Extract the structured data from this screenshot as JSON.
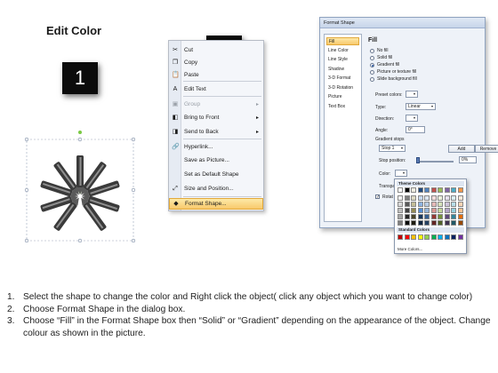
{
  "title": "Edit Color",
  "steps": [
    "1",
    "2",
    "3"
  ],
  "context_menu": {
    "items": [
      {
        "label": "Cut",
        "icon": "scissors-icon",
        "disabled": false,
        "submenu": false
      },
      {
        "label": "Copy",
        "icon": "copy-icon",
        "disabled": false,
        "submenu": false
      },
      {
        "label": "Paste",
        "icon": "paste-icon",
        "disabled": false,
        "submenu": false
      },
      {
        "label": "Edit Text",
        "icon": "edit-text-icon",
        "disabled": false,
        "submenu": false
      },
      {
        "label": "Group",
        "icon": "group-icon",
        "disabled": true,
        "submenu": true
      },
      {
        "label": "Bring to Front",
        "icon": "bring-front-icon",
        "disabled": false,
        "submenu": true
      },
      {
        "label": "Send to Back",
        "icon": "send-back-icon",
        "disabled": false,
        "submenu": true
      },
      {
        "label": "Hyperlink...",
        "icon": "hyperlink-icon",
        "disabled": false,
        "submenu": false
      },
      {
        "label": "Save as Picture...",
        "icon": "",
        "disabled": false,
        "submenu": false
      },
      {
        "label": "Set as Default Shape",
        "icon": "",
        "disabled": false,
        "submenu": false
      },
      {
        "label": "Size and Position...",
        "icon": "size-icon",
        "disabled": false,
        "submenu": false
      },
      {
        "label": "Format Shape...",
        "icon": "format-shape-icon",
        "disabled": false,
        "submenu": false,
        "highlighted": true
      }
    ]
  },
  "dialog": {
    "title": "Format Shape",
    "nav": [
      "Fill",
      "Line Color",
      "Line Style",
      "Shadow",
      "3-D Format",
      "3-D Rotation",
      "Picture",
      "Text Box"
    ],
    "heading": "Fill",
    "fill_options": [
      "No fill",
      "Solid fill",
      "Gradient fill",
      "Picture or texture fill",
      "Slide background fill"
    ],
    "selected_fill": "Gradient fill",
    "preset_colors_label": "Preset colors:",
    "type_label": "Type:",
    "type_value": "Linear",
    "direction_label": "Direction:",
    "angle_label": "Angle:",
    "angle_value": "0°",
    "gradient_stops_label": "Gradient stops",
    "stop_value": "Stop 1",
    "add_label": "Add",
    "remove_label": "Remove",
    "stop_position_label": "Stop position:",
    "stop_position_value": "0%",
    "color_label": "Color:",
    "transparency_label": "Transpa",
    "rotate_label": "Rotat"
  },
  "palette": {
    "theme_label": "Theme Colors",
    "standard_label": "Standard Colors",
    "more_label": "More Colors...",
    "theme_top": [
      "#ffffff",
      "#000000",
      "#eeece1",
      "#1f497d",
      "#4f81bd",
      "#c0504d",
      "#9bbb59",
      "#8064a2",
      "#4bacc6",
      "#f79646"
    ],
    "theme_shades": [
      [
        "#f2f2f2",
        "#7f7f7f",
        "#ddd9c3",
        "#c6d9f0",
        "#dbe5f1",
        "#f2dcdb",
        "#ebf1dd",
        "#e5e0ec",
        "#dbeef3",
        "#fdeada"
      ],
      [
        "#d8d8d8",
        "#595959",
        "#c4bd97",
        "#8db3e2",
        "#b8cce4",
        "#e5b9b7",
        "#d7e3bc",
        "#ccc1d9",
        "#b7dde8",
        "#fbd5b5"
      ],
      [
        "#bfbfbf",
        "#3f3f3f",
        "#938953",
        "#548dd4",
        "#95b3d7",
        "#d99694",
        "#c3d69b",
        "#b2a2c7",
        "#92cddc",
        "#fac08f"
      ],
      [
        "#a5a5a5",
        "#262626",
        "#494429",
        "#17365d",
        "#366092",
        "#953734",
        "#76923c",
        "#5f497a",
        "#31859b",
        "#e36c09"
      ],
      [
        "#7f7f7f",
        "#0c0c0c",
        "#1d1b10",
        "#0f243e",
        "#244061",
        "#632423",
        "#4f6128",
        "#3f3151",
        "#205867",
        "#974806"
      ]
    ],
    "standard": [
      "#c00000",
      "#ff0000",
      "#ffc000",
      "#ffff00",
      "#92d050",
      "#00b050",
      "#00b0f0",
      "#0070c0",
      "#002060",
      "#7030a0"
    ]
  },
  "instructions": [
    {
      "num": "1.",
      "text": "Select the shape to change the color and Right click the object( click any object which you want to change color)"
    },
    {
      "num": "2.",
      "text": "Choose Format Shape in the dialog box."
    },
    {
      "num": "3.",
      "text": "Choose “Fill” in the Format Shape box then “Solid” or “Gradient” depending on the appearance of the object. Change colour as shown in the picture."
    }
  ],
  "colors": {
    "step_box": "#0b0b0b",
    "pencil_body": "#3a3a3a",
    "pencil_highlight": "#8cc63f",
    "menu_highlight": "#f8c86b"
  }
}
